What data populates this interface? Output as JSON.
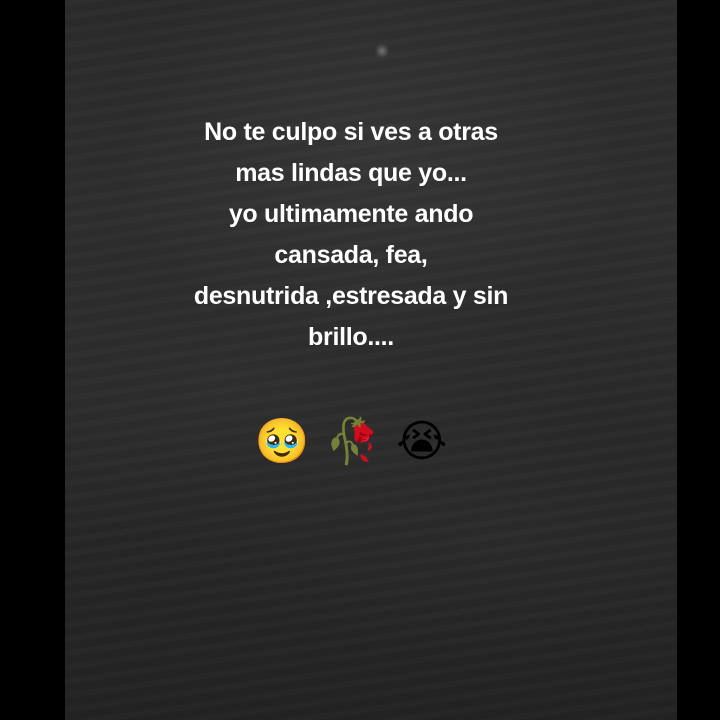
{
  "caption": {
    "lines": [
      "No te culpo si ves a otras",
      "mas lindas que yo...",
      "yo ultimamente ando",
      "cansada, fea,",
      "desnutrida ,estresada y sin",
      "brillo...."
    ]
  },
  "emojis": [
    "🥹",
    "🥀",
    "😭"
  ],
  "colors": {
    "background": "#000000",
    "video": "#2b2b2b",
    "text": "#ffffff"
  }
}
